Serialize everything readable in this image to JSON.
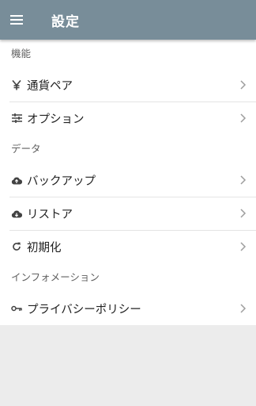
{
  "appbar": {
    "title": "設定",
    "color": "#788d99"
  },
  "sections": [
    {
      "header": "機能",
      "items": [
        {
          "label": "通貨ペア",
          "icon": "yen-icon"
        },
        {
          "label": "オプション",
          "icon": "tune-icon"
        }
      ]
    },
    {
      "header": "データ",
      "items": [
        {
          "label": "バックアップ",
          "icon": "cloud-upload-icon"
        },
        {
          "label": "リストア",
          "icon": "cloud-download-icon"
        },
        {
          "label": "初期化",
          "icon": "refresh-icon"
        }
      ]
    },
    {
      "header": "インフォメーション",
      "items": [
        {
          "label": "プライバシーポリシー",
          "icon": "key-icon"
        }
      ]
    }
  ]
}
